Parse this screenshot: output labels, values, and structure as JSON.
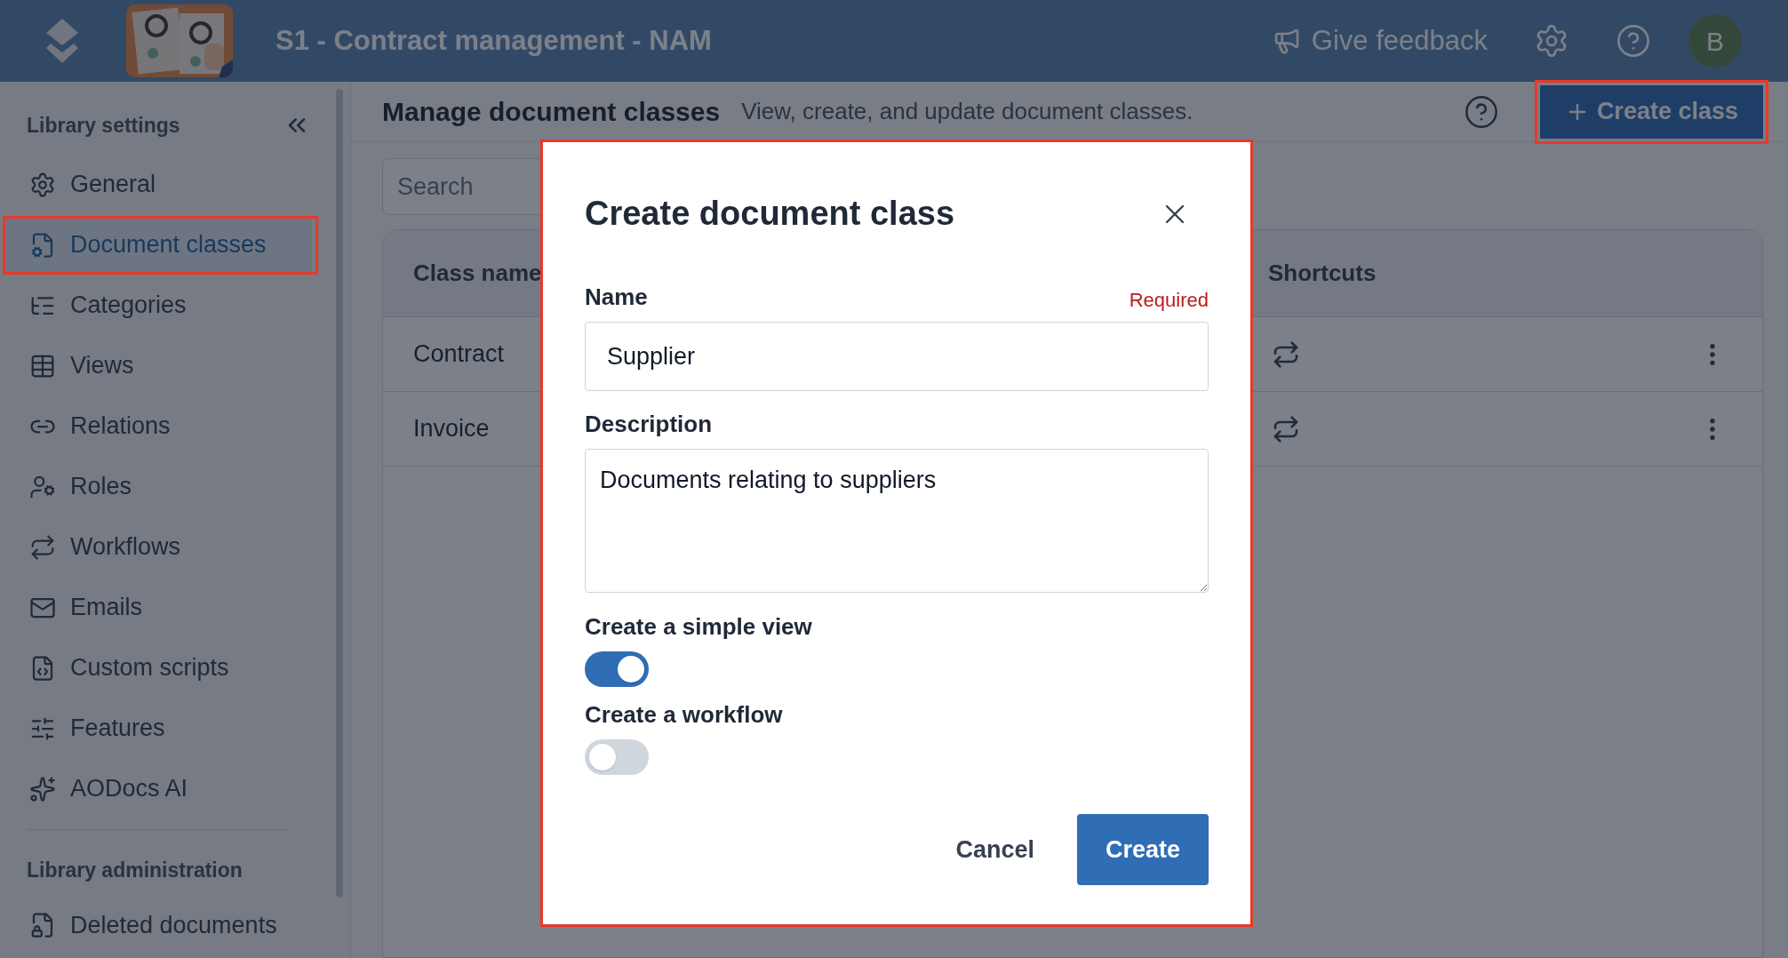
{
  "top_bar": {
    "title": "S1 - Contract management - NAM",
    "feedback": "Give feedback",
    "avatar": "B"
  },
  "sidebar": {
    "section_title": "Library settings",
    "items": [
      {
        "label": "General",
        "selected": false,
        "highlighted": false
      },
      {
        "label": "Document classes",
        "selected": true,
        "highlighted": true
      },
      {
        "label": "Categories",
        "selected": false,
        "highlighted": false
      },
      {
        "label": "Views",
        "selected": false,
        "highlighted": false
      },
      {
        "label": "Relations",
        "selected": false,
        "highlighted": false
      },
      {
        "label": "Roles",
        "selected": false,
        "highlighted": false
      },
      {
        "label": "Workflows",
        "selected": false,
        "highlighted": false
      },
      {
        "label": "Emails",
        "selected": false,
        "highlighted": false
      },
      {
        "label": "Custom scripts",
        "selected": false,
        "highlighted": false
      },
      {
        "label": "Features",
        "selected": false,
        "highlighted": false
      },
      {
        "label": "AODocs AI",
        "selected": false,
        "highlighted": false
      }
    ],
    "admin_title": "Library administration",
    "admin_items": [
      {
        "label": "Deleted documents",
        "selected": false,
        "highlighted": false
      }
    ]
  },
  "header": {
    "title": "Manage document classes",
    "subtitle": "View, create, and update document classes.",
    "create_button": "Create class",
    "create_highlighted": true
  },
  "search": {
    "placeholder": "Search"
  },
  "table": {
    "columns": [
      "Class name",
      "Shortcuts"
    ],
    "rows": [
      {
        "name": "Contract"
      },
      {
        "name": "Invoice"
      }
    ]
  },
  "dialog": {
    "title": "Create document class",
    "highlighted": true,
    "name_label": "Name",
    "required": "Required",
    "name_value": "Supplier",
    "description_label": "Description",
    "description_value": "Documents relating to suppliers",
    "toggles": [
      {
        "label": "Create a simple view",
        "on": true
      },
      {
        "label": "Create a workflow",
        "on": false
      }
    ],
    "cancel": "Cancel",
    "create": "Create"
  }
}
